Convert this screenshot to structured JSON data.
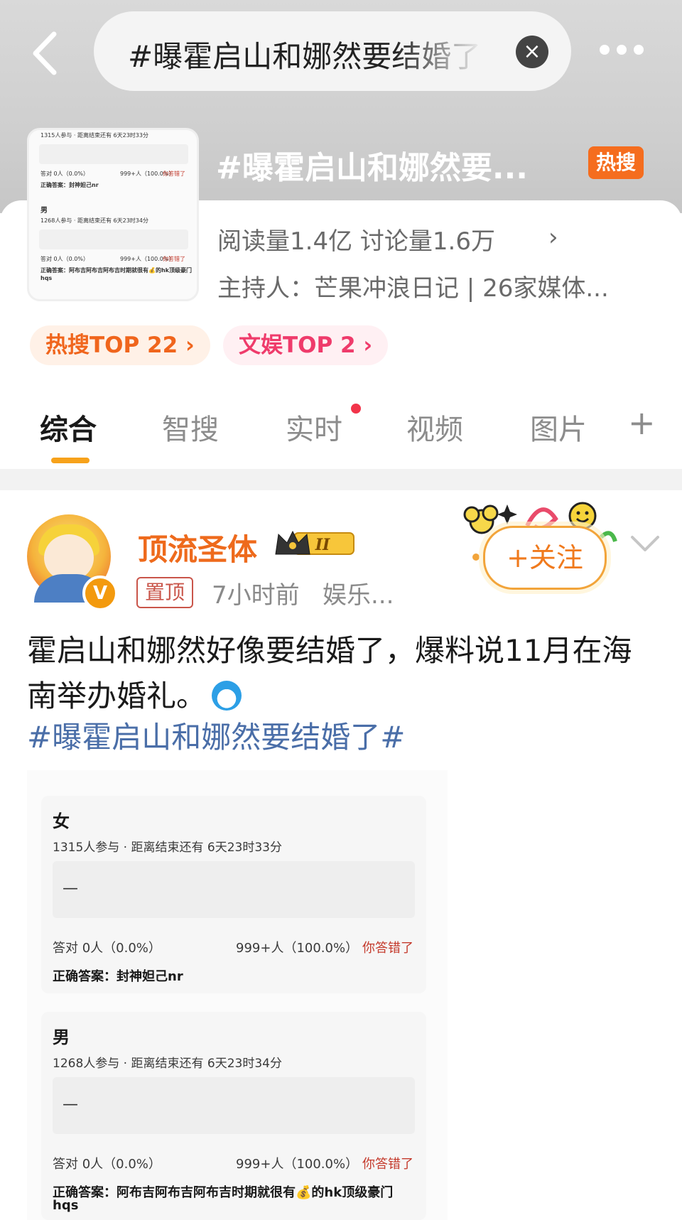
{
  "search": {
    "query": "#曝霍启山和娜然要结婚了"
  },
  "topic": {
    "title": "#曝霍启山和娜然要...",
    "hot_badge": "热搜",
    "stats": "阅读量1.4亿  讨论量1.6万",
    "host": "主持人：芒果冲浪日记 | 26家媒体...",
    "chips": [
      "热搜TOP 22",
      "文娱TOP 2"
    ],
    "thumb": {
      "line1": "1315人参与 · 距离结束还有 6天23时33分",
      "line2_left": "答对  0人（0.0%）",
      "line2_mid": "999+人（100.0%）",
      "line2_wrong": "你答错了",
      "answer1": "正确答案：封神妲己nr",
      "title2": "男",
      "line3": "1268人参与 · 距离结束还有 6天23时34分",
      "answer2": "正确答案：阿布吉阿布吉阿布吉时期就很有💰的hk顶级豪门",
      "answer2b": "hqs"
    }
  },
  "tabs": [
    "综合",
    "智搜",
    "实时",
    "视频",
    "图片"
  ],
  "tab_add": "+",
  "post": {
    "author": "顶流圣体",
    "level": "II",
    "pinned": "置顶",
    "time": "7小时前",
    "source": "娱乐...",
    "follow": "+关注",
    "text": "霍启山和娜然好像要结婚了，爆料说11月在海南举办婚礼。",
    "hashtag": "#曝霍启山和娜然要结婚了#"
  },
  "embed": {
    "cards": [
      {
        "title": "女",
        "meta": "1315人参与 · 距离结束还有 6天23时33分",
        "dash": "—",
        "correct": "答对  0人（0.0%）",
        "wrong_count": "999+人（100.0%）",
        "wrong_label": "你答错了",
        "answer": "正确答案：封神妲己nr"
      },
      {
        "title": "男",
        "meta": "1268人参与 · 距离结束还有 6天23时34分",
        "dash": "—",
        "correct": "答对  0人（0.0%）",
        "wrong_count": "999+人（100.0%）",
        "wrong_label": "你答错了",
        "answer": "正确答案：阿布吉阿布吉阿布吉时期就很有💰的hk顶级豪门",
        "answer_line2": "hqs"
      }
    ]
  },
  "colors": {
    "accent_orange": "#f56d1e",
    "link_blue": "#4a6ea8",
    "tab_underline": "#f7a21b"
  }
}
